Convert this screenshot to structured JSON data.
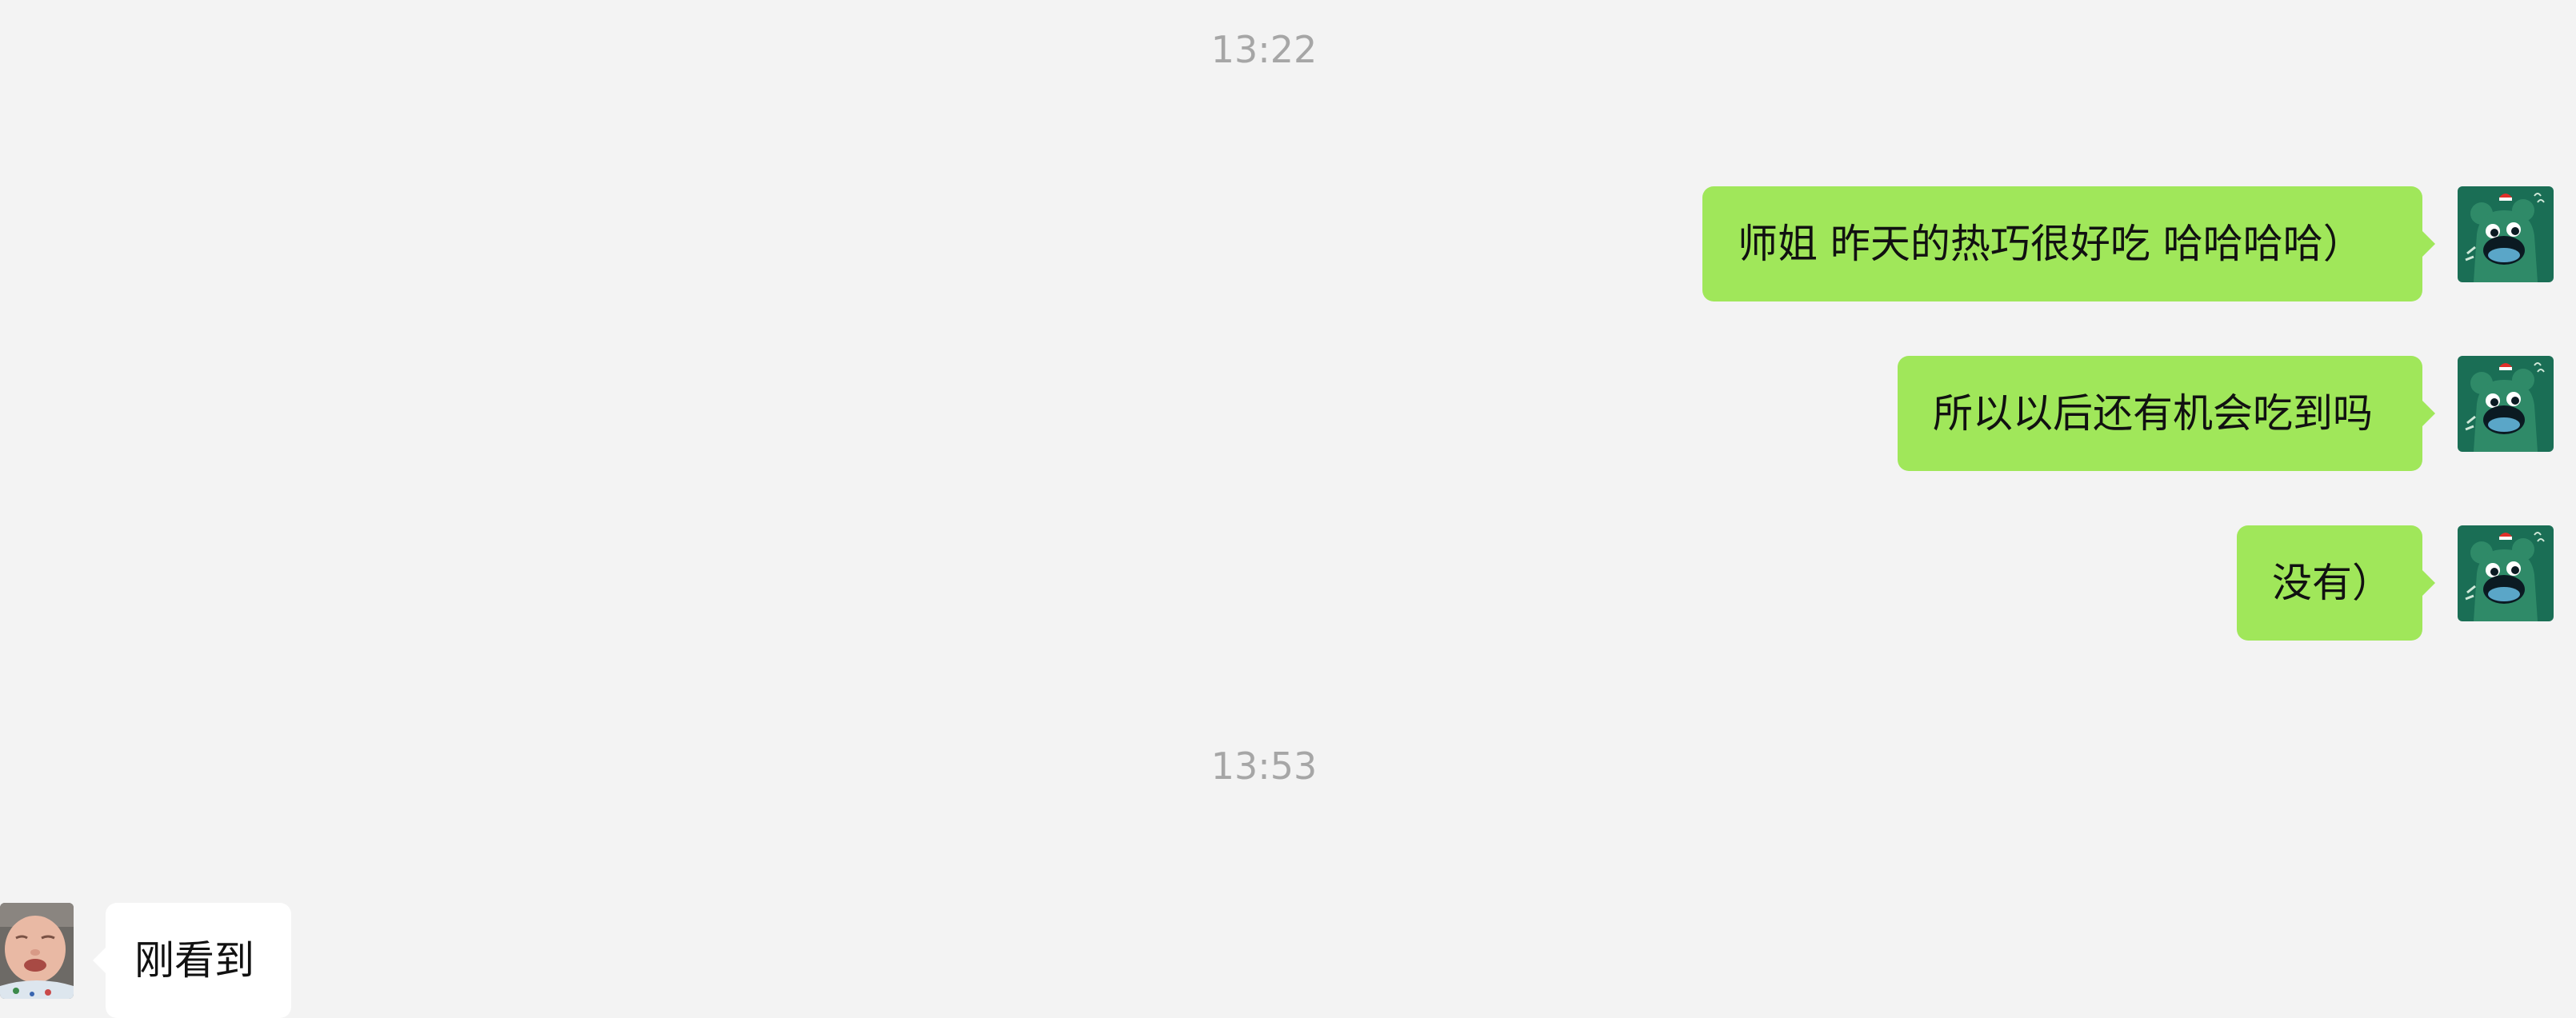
{
  "conversation": {
    "timestamps": [
      "13:22",
      "13:53"
    ],
    "messages": [
      {
        "side": "right",
        "sender": "self",
        "avatar": "green-bear-avatar",
        "text": "师姐 昨天的热巧很好吃 哈哈哈哈）"
      },
      {
        "side": "right",
        "sender": "self",
        "avatar": "green-bear-avatar",
        "text": "所以以后还有机会吃到吗"
      },
      {
        "side": "right",
        "sender": "self",
        "avatar": "green-bear-avatar",
        "text": "没有）"
      },
      {
        "side": "left",
        "sender": "other",
        "avatar": "baby-photo-avatar",
        "text": "刚看到"
      }
    ]
  },
  "colors": {
    "background": "#f3f3f3",
    "outgoing_bubble": "#a0e75a",
    "incoming_bubble": "#ffffff",
    "timestamp_text": "#a6a6a6",
    "avatar_green": "#1a6e55"
  }
}
